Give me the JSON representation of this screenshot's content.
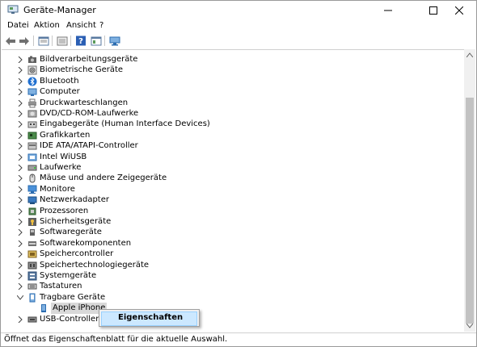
{
  "window": {
    "title": "Geräte-Manager"
  },
  "menu": [
    "Datei",
    "Aktion",
    "Ansicht",
    "?"
  ],
  "toolbar": [
    "back-icon",
    "forward-icon",
    "properties-icon",
    "show-hidden-icon",
    "help-icon",
    "view-icon",
    "monitor-icon"
  ],
  "tree": [
    {
      "label": "Bildverarbeitungsgeräte",
      "icon": "camera-icon",
      "expanded": false
    },
    {
      "label": "Biometrische Geräte",
      "icon": "fingerprint-icon",
      "expanded": false
    },
    {
      "label": "Bluetooth",
      "icon": "bluetooth-icon",
      "expanded": false
    },
    {
      "label": "Computer",
      "icon": "computer-icon",
      "expanded": false
    },
    {
      "label": "Druckwarteschlangen",
      "icon": "printer-icon",
      "expanded": false
    },
    {
      "label": "DVD/CD-ROM-Laufwerke",
      "icon": "disc-icon",
      "expanded": false
    },
    {
      "label": "Eingabegeräte (Human Interface Devices)",
      "icon": "hid-icon",
      "expanded": false
    },
    {
      "label": "Grafikkarten",
      "icon": "gpu-icon",
      "expanded": false
    },
    {
      "label": "IDE ATA/ATAPI-Controller",
      "icon": "ide-icon",
      "expanded": false
    },
    {
      "label": "Intel WiUSB",
      "icon": "usb-device-icon",
      "expanded": false
    },
    {
      "label": "Laufwerke",
      "icon": "drive-icon",
      "expanded": false
    },
    {
      "label": "Mäuse und andere Zeigegeräte",
      "icon": "mouse-icon",
      "expanded": false
    },
    {
      "label": "Monitore",
      "icon": "monitor-icon",
      "expanded": false
    },
    {
      "label": "Netzwerkadapter",
      "icon": "network-icon",
      "expanded": false
    },
    {
      "label": "Prozessoren",
      "icon": "cpu-icon",
      "expanded": false
    },
    {
      "label": "Sicherheitsgeräte",
      "icon": "security-icon",
      "expanded": false
    },
    {
      "label": "Softwaregeräte",
      "icon": "software-device-icon",
      "expanded": false
    },
    {
      "label": "Softwarekomponenten",
      "icon": "software-component-icon",
      "expanded": false
    },
    {
      "label": "Speichercontroller",
      "icon": "storage-controller-icon",
      "expanded": false
    },
    {
      "label": "Speichertechnologiegeräte",
      "icon": "storage-tech-icon",
      "expanded": false
    },
    {
      "label": "Systemgeräte",
      "icon": "system-icon",
      "expanded": false
    },
    {
      "label": "Tastaturen",
      "icon": "keyboard-icon",
      "expanded": false
    },
    {
      "label": "Tragbare Geräte",
      "icon": "portable-device-icon",
      "expanded": true
    },
    {
      "label": "Apple iPhone",
      "icon": "phone-icon",
      "child": true,
      "selected": true
    },
    {
      "label": "USB-Controller",
      "icon": "usb-icon",
      "expanded": false
    }
  ],
  "context_menu": {
    "item": "Eigenschaften"
  },
  "status": "Öffnet das Eigenschaftenblatt für die aktuelle Auswahl.",
  "colors": {
    "selection": "#d9d9d9",
    "menu_highlight": "#cce8ff",
    "icon_blue": "#2b6cb0"
  }
}
